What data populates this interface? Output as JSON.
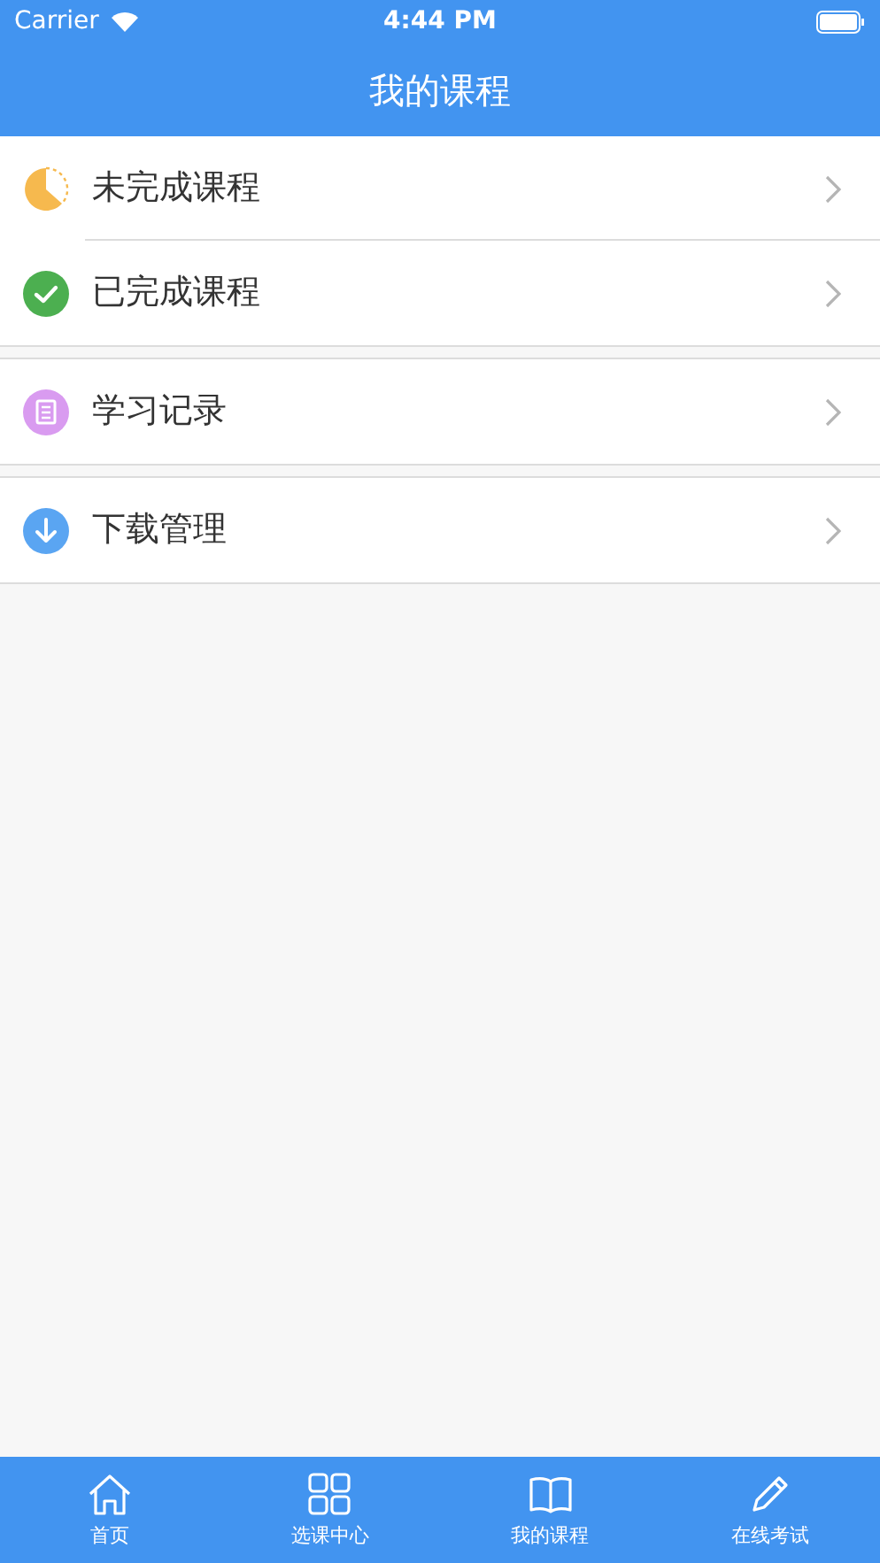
{
  "status_bar": {
    "carrier": "Carrier",
    "time": "4:44 PM"
  },
  "nav": {
    "title": "我的课程"
  },
  "groups": [
    {
      "items": [
        {
          "kind": "pending",
          "label": "未完成课程"
        },
        {
          "kind": "done",
          "label": "已完成课程"
        }
      ]
    },
    {
      "items": [
        {
          "kind": "record",
          "label": "学习记录"
        }
      ]
    },
    {
      "items": [
        {
          "kind": "download",
          "label": "下载管理"
        }
      ]
    }
  ],
  "tabs": [
    {
      "kind": "home",
      "label": "首页"
    },
    {
      "kind": "grid",
      "label": "选课中心"
    },
    {
      "kind": "course",
      "label": "我的课程"
    },
    {
      "kind": "exam",
      "label": "在线考试"
    }
  ]
}
